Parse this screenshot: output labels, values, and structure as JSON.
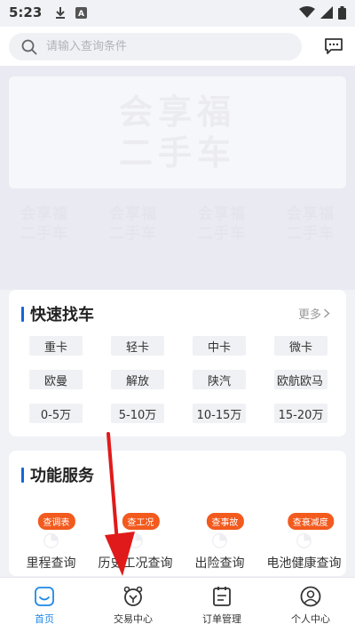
{
  "status_bar": {
    "time": "5:23"
  },
  "search": {
    "placeholder": "请输入查询条件"
  },
  "banner": {
    "watermark_line1": "会享福",
    "watermark_line2": "二手车"
  },
  "quick_find": {
    "title": "快速找车",
    "more": "更多",
    "tags": [
      "重卡",
      "轻卡",
      "中卡",
      "微卡",
      "欧曼",
      "解放",
      "陕汽",
      "欧航欧马",
      "0-5万",
      "5-10万",
      "10-15万",
      "15-20万"
    ]
  },
  "services": {
    "title": "功能服务",
    "items": [
      {
        "badge": "查调表",
        "label": "里程查询"
      },
      {
        "badge": "查工况",
        "label": "历史工况查询"
      },
      {
        "badge": "查事故",
        "label": "出险查询"
      },
      {
        "badge": "查衰减度",
        "label": "电池健康查询"
      }
    ]
  },
  "tabbar": {
    "items": [
      {
        "label": "首页",
        "icon": "home-icon",
        "active": true
      },
      {
        "label": "交易中心",
        "icon": "trade-icon",
        "active": false
      },
      {
        "label": "订单管理",
        "icon": "order-icon",
        "active": false
      },
      {
        "label": "个人中心",
        "icon": "person-icon",
        "active": false
      }
    ]
  },
  "colors": {
    "accent": "#1e88e5",
    "title_bar": "#1565d8",
    "badge": "#f25a1e",
    "arrow": "#e01a1a"
  }
}
